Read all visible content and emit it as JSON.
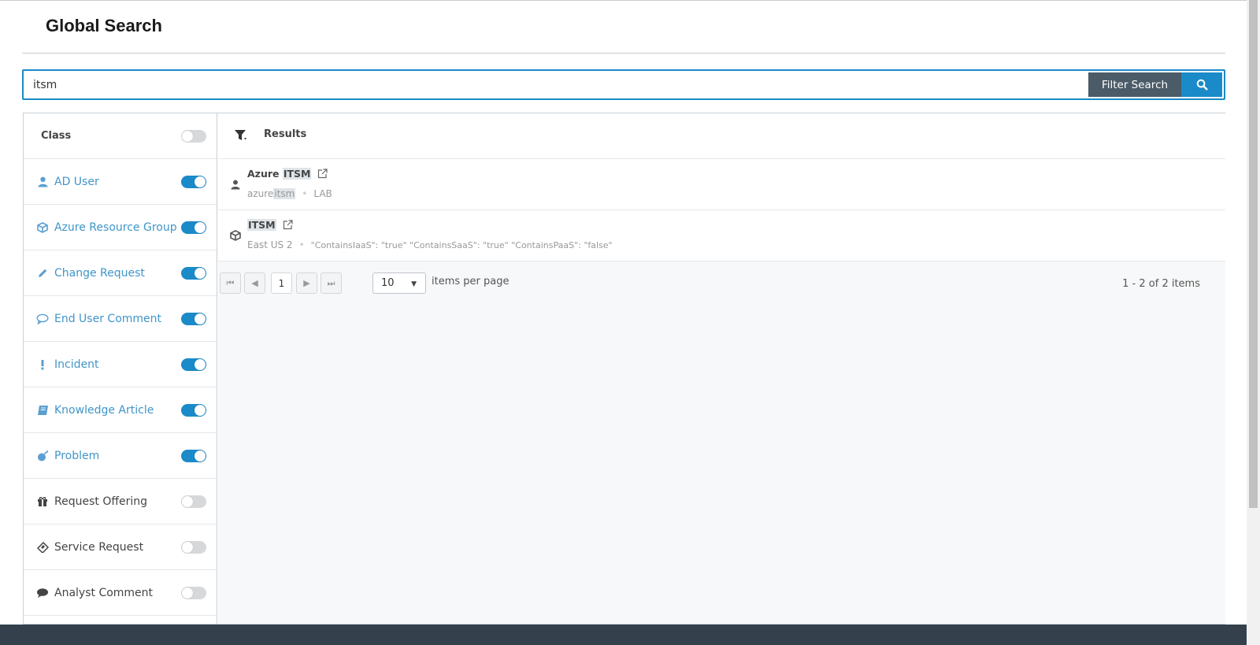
{
  "page": {
    "title": "Global Search"
  },
  "search": {
    "value": "itsm",
    "filter_button_label": "Filter Search",
    "search_icon": "search-icon"
  },
  "sidebar": {
    "header": {
      "label": "Class",
      "toggle_on": false
    },
    "items": [
      {
        "label": "AD User",
        "icon": "user-icon",
        "on": true
      },
      {
        "label": "Azure Resource Group",
        "icon": "cube-icon",
        "on": true
      },
      {
        "label": "Change Request",
        "icon": "pencil-icon",
        "on": true
      },
      {
        "label": "End User Comment",
        "icon": "speech-bubble-icon",
        "on": true
      },
      {
        "label": "Incident",
        "icon": "exclamation-icon",
        "on": true
      },
      {
        "label": "Knowledge Article",
        "icon": "book-icon",
        "on": true
      },
      {
        "label": "Problem",
        "icon": "bomb-icon",
        "on": true
      },
      {
        "label": "Request Offering",
        "icon": "gift-icon",
        "on": false
      },
      {
        "label": "Service Request",
        "icon": "ticket-icon",
        "on": false
      },
      {
        "label": "Analyst Comment",
        "icon": "comment-icon",
        "on": false
      }
    ]
  },
  "results": {
    "header": "Results",
    "items": [
      {
        "title_prefix": "Azure ",
        "title_highlight": "ITSM",
        "icon": "user-icon",
        "meta_prefix": "azure",
        "meta_highlight": "itsm",
        "meta_suffix": "LAB"
      },
      {
        "title_prefix": "",
        "title_highlight": "ITSM",
        "icon": "cube-icon",
        "meta_prefix": "East US 2",
        "meta_highlight": "",
        "meta_suffix": "\"ContainsIaaS\": \"true\" \"ContainsSaaS\": \"true\" \"ContainsPaaS\": \"false\""
      }
    ]
  },
  "pager": {
    "current_page": "1",
    "page_size": "10",
    "page_size_label": "items per page",
    "count_label": "1 - 2 of 2 items"
  },
  "colors": {
    "accent": "#1a8ac9",
    "filter_button": "#4b5b68",
    "footer": "#34414c",
    "active_label": "#3f95c9"
  }
}
